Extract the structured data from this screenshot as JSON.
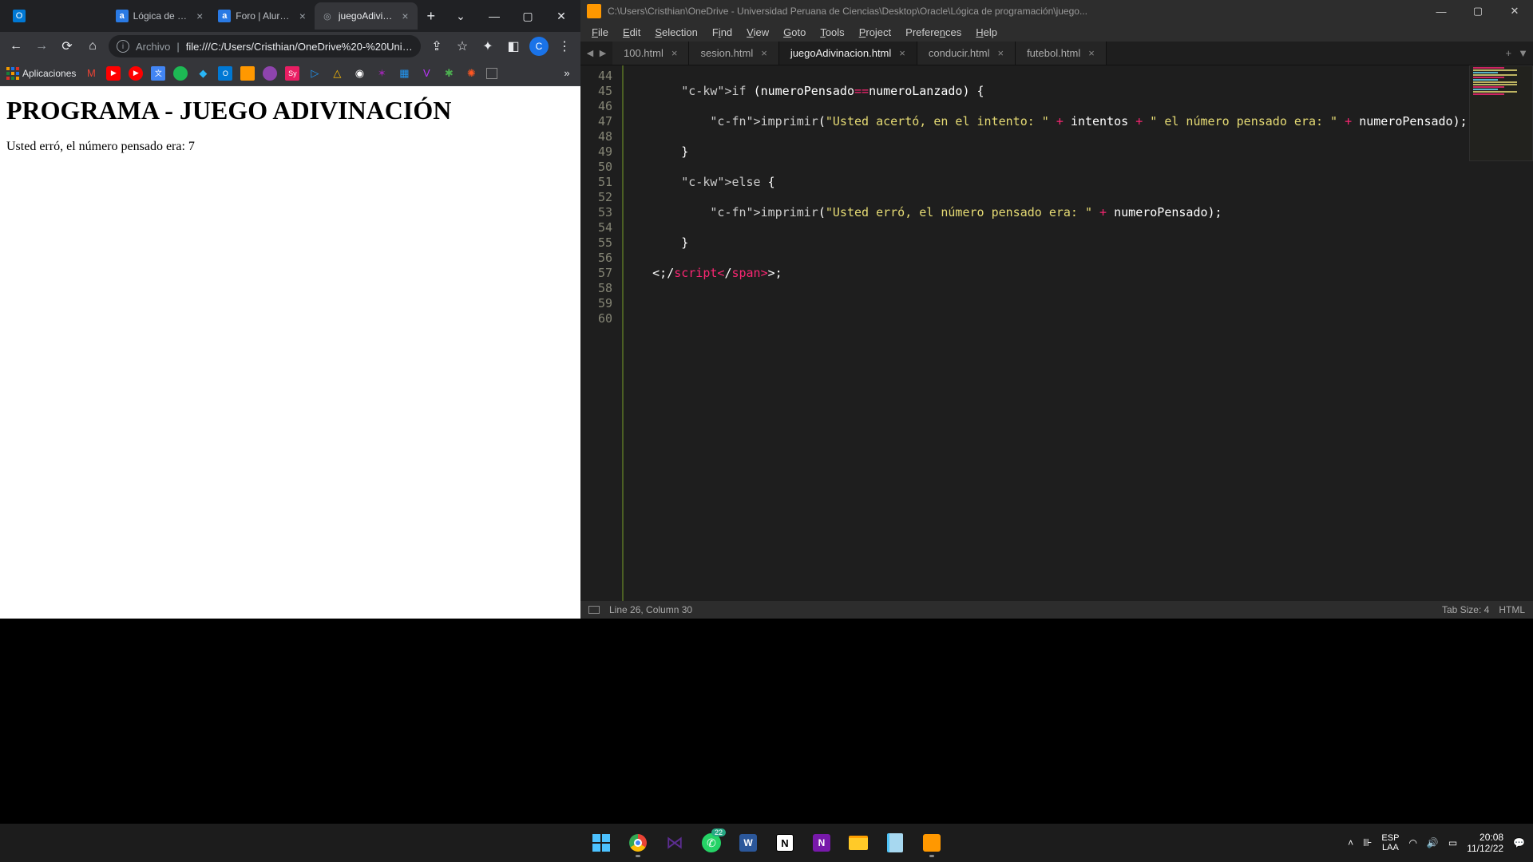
{
  "chrome": {
    "tabs": [
      {
        "title": "",
        "favicon": "📧"
      },
      {
        "title": "Lógica de progr",
        "favicon": "a"
      },
      {
        "title": "Foro | Alura Lata",
        "favicon": "a"
      },
      {
        "title": "juegoAdivinacio",
        "favicon": "◎",
        "active": true
      }
    ],
    "omnibox": {
      "label": "Archivo",
      "url": "file:///C:/Users/Cristhian/OneDrive%20-%20Unive..."
    },
    "avatar_letter": "C",
    "bookmarks": {
      "apps_label": "Aplicaciones"
    },
    "page": {
      "heading": "PROGRAMA - JUEGO ADIVINACIÓN",
      "body_text": "Usted erró, el número pensado era: 7"
    }
  },
  "sublime": {
    "title_path": "C:\\Users\\Cristhian\\OneDrive - Universidad Peruana de Ciencias\\Desktop\\Oracle\\Lógica de programación\\juego...",
    "menu": [
      "File",
      "Edit",
      "Selection",
      "Find",
      "View",
      "Goto",
      "Tools",
      "Project",
      "Preferences",
      "Help"
    ],
    "tabs": [
      {
        "name": "100.html"
      },
      {
        "name": "sesion.html"
      },
      {
        "name": "juegoAdivinacion.html",
        "active": true
      },
      {
        "name": "conducir.html"
      },
      {
        "name": "futebol.html"
      }
    ],
    "first_line_no": 44,
    "code_rows": [
      "",
      "        if (numeroPensado==numeroLanzado) {",
      "",
      "            imprimir(\"Usted acertó, en el intento: \" + intentos + \" el número pensado era: \" + numeroPensado);",
      "",
      "        }",
      "",
      "        else {",
      "",
      "            imprimir(\"Usted erró, el número pensado era: \" + numeroPensado);",
      "",
      "        }",
      "",
      "    </script_>",
      "",
      "",
      ""
    ],
    "status": {
      "pos": "Line 26, Column 30",
      "tab": "Tab Size: 4",
      "lang": "HTML"
    }
  },
  "taskbar": {
    "lang_top": "ESP",
    "lang_bot": "LAA",
    "time": "20:08",
    "date": "11/12/22",
    "whatsapp_badge": "22"
  }
}
